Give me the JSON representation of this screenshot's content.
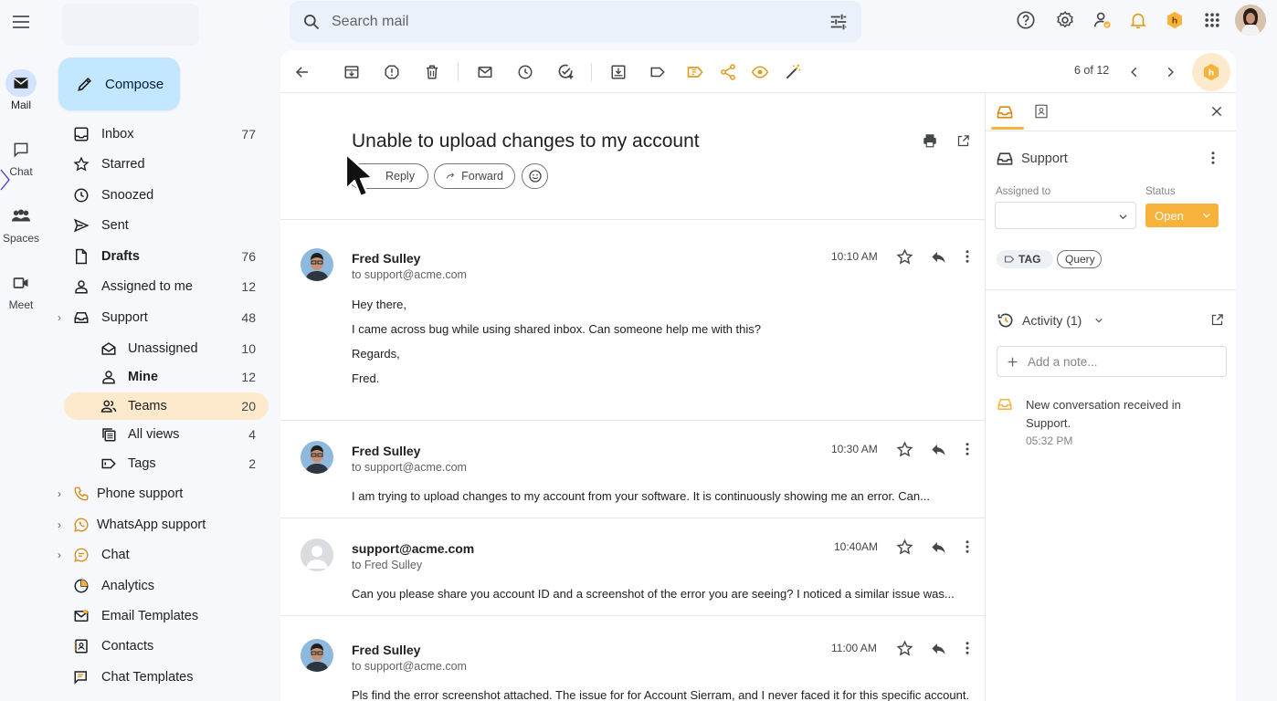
{
  "rail": {
    "items": [
      {
        "label": "Mail"
      },
      {
        "label": "Chat"
      },
      {
        "label": "Spaces"
      },
      {
        "label": "Meet"
      }
    ]
  },
  "search": {
    "placeholder": "Search mail"
  },
  "compose": {
    "label": "Compose"
  },
  "nav": [
    {
      "label": "Inbox",
      "count": "77"
    },
    {
      "label": "Starred",
      "count": ""
    },
    {
      "label": "Snoozed",
      "count": ""
    },
    {
      "label": "Sent",
      "count": ""
    },
    {
      "label": "Drafts",
      "count": "76"
    },
    {
      "label": "Assigned to me",
      "count": "12"
    },
    {
      "label": "Support",
      "count": "48"
    },
    {
      "label": "Unassigned",
      "count": "10"
    },
    {
      "label": "Mine",
      "count": "12"
    },
    {
      "label": "Teams",
      "count": "20"
    },
    {
      "label": "All views",
      "count": "4"
    },
    {
      "label": "Tags",
      "count": "2"
    },
    {
      "label": "Phone support",
      "count": ""
    },
    {
      "label": "WhatsApp support",
      "count": ""
    },
    {
      "label": "Chat",
      "count": ""
    },
    {
      "label": "Analytics",
      "count": ""
    },
    {
      "label": "Email Templates",
      "count": ""
    },
    {
      "label": "Contacts",
      "count": ""
    },
    {
      "label": "Chat Templates",
      "count": ""
    }
  ],
  "toolbar": {
    "pager": "6 of 12"
  },
  "thread": {
    "subject": "Unable to upload changes to my account",
    "reply_label": "Reply",
    "forward_label": "Forward",
    "messages": [
      {
        "sender": "Fred Sulley",
        "to": "to support@acme.com",
        "time": "10:10 AM",
        "lines": [
          "Hey there,",
          "I came across bug while using shared inbox. Can someone help me with this?",
          "Regards,",
          "Fred."
        ]
      },
      {
        "sender": "Fred Sulley",
        "to": "to support@acme.com",
        "time": "10:30 AM",
        "lines": [
          "I am trying to upload changes to my account from your software. It is continuously showing me an error. Can..."
        ]
      },
      {
        "sender": "support@acme.com",
        "to": "to Fred Sulley",
        "time": "10:40AM",
        "lines": [
          "Can you please share you account ID and a screenshot of the error you are seeing? I noticed a similar issue was..."
        ]
      },
      {
        "sender": "Fred Sulley",
        "to": "to support@acme.com",
        "time": "11:00 AM",
        "lines": [
          "Pls find the error screenshot attached. The issue for for Account Sierram, and I never faced it for this specific account."
        ]
      }
    ]
  },
  "panel": {
    "inbox_name": "Support",
    "assigned_label": "Assigned to",
    "status_label": "Status",
    "status_value": "Open",
    "tags": [
      "TAG",
      "Query"
    ],
    "activity_label": "Activity (1)",
    "note_placeholder": "Add a note...",
    "activity": {
      "text": "New conversation received in Support.",
      "time": "05:32 PM"
    }
  },
  "colors": {
    "accent": "#f7b23b",
    "compose_bg": "#c2e7ff",
    "selected_nav": "#fde9cc"
  }
}
